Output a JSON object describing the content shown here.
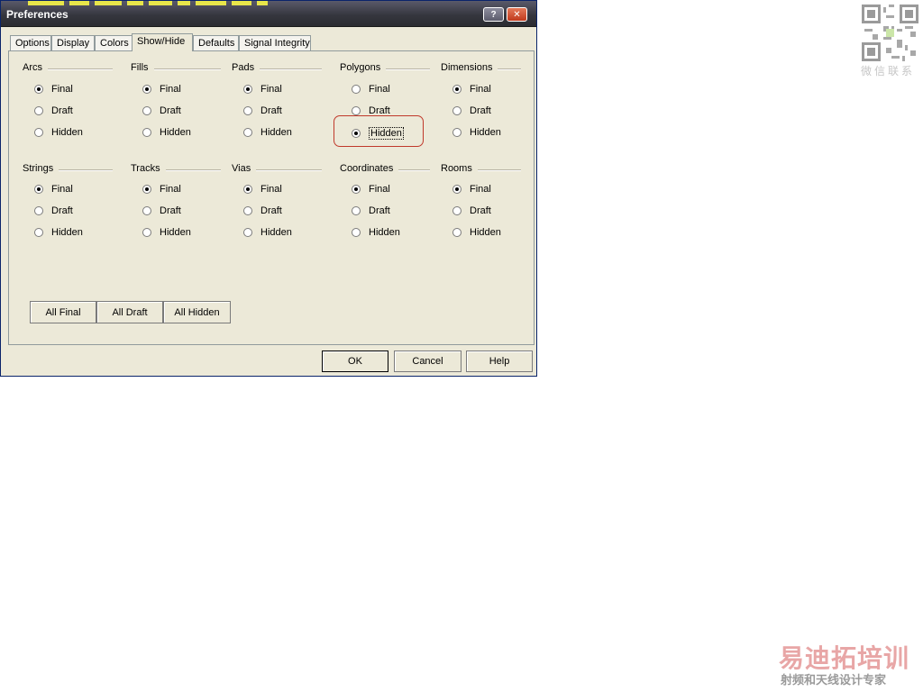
{
  "window": {
    "title": "Preferences",
    "help_button": "?",
    "close_button": "✕"
  },
  "tabs": [
    "Options",
    "Display",
    "Colors",
    "Show/Hide",
    "Defaults",
    "Signal Integrity"
  ],
  "active_tab": "Show/Hide",
  "radio_options": [
    "Final",
    "Draft",
    "Hidden"
  ],
  "groups": [
    {
      "label": "Arcs",
      "selected": "Final"
    },
    {
      "label": "Fills",
      "selected": "Final"
    },
    {
      "label": "Pads",
      "selected": "Final"
    },
    {
      "label": "Polygons",
      "selected": "Hidden"
    },
    {
      "label": "Dimensions",
      "selected": "Final"
    },
    {
      "label": "Strings",
      "selected": "Final"
    },
    {
      "label": "Tracks",
      "selected": "Final"
    },
    {
      "label": "Vias",
      "selected": "Final"
    },
    {
      "label": "Coordinates",
      "selected": "Final"
    },
    {
      "label": "Rooms",
      "selected": "Final"
    }
  ],
  "bulk_buttons": {
    "all_final": "All Final",
    "all_draft": "All Draft",
    "all_hidden": "All Hidden"
  },
  "dialog_buttons": {
    "ok": "OK",
    "cancel": "Cancel",
    "help": "Help"
  },
  "watermark": {
    "qr_caption": "微信联系",
    "brand": "易迪拓培训",
    "brand_sub": "射频和天线设计专家"
  },
  "colors": {
    "highlight": "#c0392b",
    "dialog_bg": "#ece9d8"
  }
}
